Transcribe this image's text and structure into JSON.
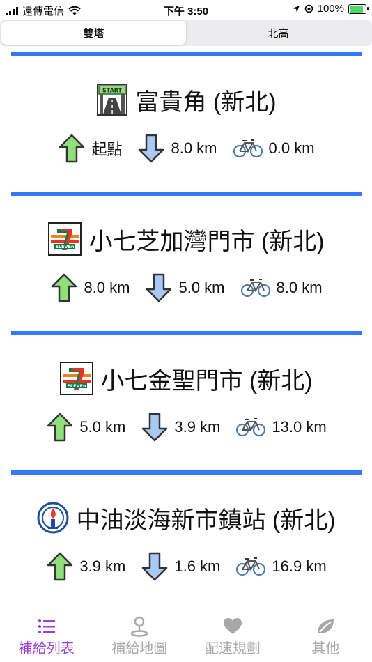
{
  "status_bar": {
    "carrier": "遠傳電信",
    "time": "下午 3:50",
    "battery": "100%"
  },
  "segments": [
    {
      "label": "雙塔",
      "active": true
    },
    {
      "label": "北高",
      "active": false
    }
  ],
  "stops": [
    {
      "icon": "start-gate-icon",
      "name": "富貴角 (新北)",
      "up": "起點",
      "down": "8.0 km",
      "ride": "0.0 km"
    },
    {
      "icon": "seven-eleven-icon",
      "name": "小七芝加灣門市 (新北)",
      "up": "8.0 km",
      "down": "5.0 km",
      "ride": "8.0 km"
    },
    {
      "icon": "seven-eleven-icon",
      "name": "小七金聖門市 (新北)",
      "up": "5.0 km",
      "down": "3.9 km",
      "ride": "13.0 km"
    },
    {
      "icon": "cpc-logo-icon",
      "name": "中油淡海新市鎮站 (新北)",
      "up": "3.9 km",
      "down": "1.6 km",
      "ride": "16.9 km"
    }
  ],
  "tabs": [
    {
      "label": "補給列表",
      "icon": "list-icon",
      "active": true
    },
    {
      "label": "補給地圖",
      "icon": "map-pin-icon",
      "active": false
    },
    {
      "label": "配速規劃",
      "icon": "heart-icon",
      "active": false
    },
    {
      "label": "其他",
      "icon": "leaf-icon",
      "active": false
    }
  ],
  "colors": {
    "divider": "#3478f6",
    "up_arrow": "#8fe07a",
    "down_arrow": "#a9c9f2",
    "tab_active": "#9b3fd8",
    "tab_inactive": "#a8a8a8"
  }
}
